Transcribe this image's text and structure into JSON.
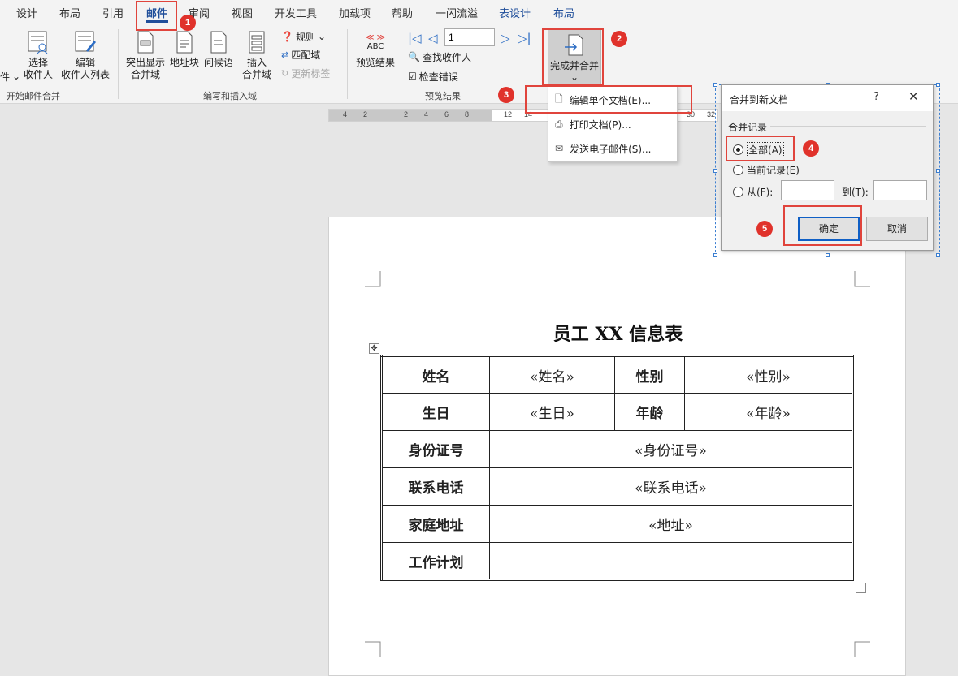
{
  "ribbon_tabs": [
    "设计",
    "布局",
    "引用",
    "邮件",
    "审阅",
    "视图",
    "开发工具",
    "加载项",
    "帮助",
    "一闪流溢",
    "表设计",
    "布局"
  ],
  "active_tab": "邮件",
  "groups": {
    "start_merge": {
      "label": "开始邮件合并",
      "partial_left": "件",
      "select_recipients": "选择\n收件人",
      "edit_list": "编辑\n收件人列表"
    },
    "write_insert": {
      "label": "编写和插入域",
      "highlight_fields": "突出显示\n合并域",
      "address_block": "地址块",
      "greeting": "问候语",
      "insert_field": "插入\n合并域",
      "rules": "规则",
      "match_fields": "匹配域",
      "update_labels": "更新标签"
    },
    "preview": {
      "label": "预览结果",
      "preview_btn": "预览结果",
      "abc": "ABC",
      "record": "1",
      "find_recipient": "查找收件人",
      "check_errors": "检查错误"
    },
    "finish": {
      "label": "完成并合并"
    }
  },
  "ruler_ticks": [
    "4",
    "2",
    "2",
    "4",
    "6",
    "8",
    "12",
    "14",
    "30",
    "32"
  ],
  "dropdown": {
    "items": [
      "编辑单个文档(E)...",
      "打印文档(P)...",
      "发送电子邮件(S)..."
    ]
  },
  "document": {
    "title": "员工 XX 信息表",
    "rows": [
      [
        "姓名",
        "«姓名»",
        "性别",
        "«性别»"
      ],
      [
        "生日",
        "«生日»",
        "年龄",
        "«年龄»"
      ],
      [
        "身份证号",
        "«身份证号»"
      ],
      [
        "联系电话",
        "«联系电话»"
      ],
      [
        "家庭地址",
        "«地址»"
      ],
      [
        "工作计划",
        ""
      ]
    ]
  },
  "dialog": {
    "title": "合并到新文档",
    "help": "?",
    "close": "✕",
    "section": "合并记录",
    "options": [
      "全部(A)",
      "当前记录(E)",
      "从(F):"
    ],
    "selected": 0,
    "to_label": "到(T):",
    "from_value": "",
    "to_value": "",
    "ok": "确定",
    "cancel": "取消"
  },
  "annotations": [
    "1",
    "2",
    "3",
    "4",
    "5"
  ],
  "colors": {
    "accent": "#1f4e9a",
    "annotation": "#e0322b"
  }
}
